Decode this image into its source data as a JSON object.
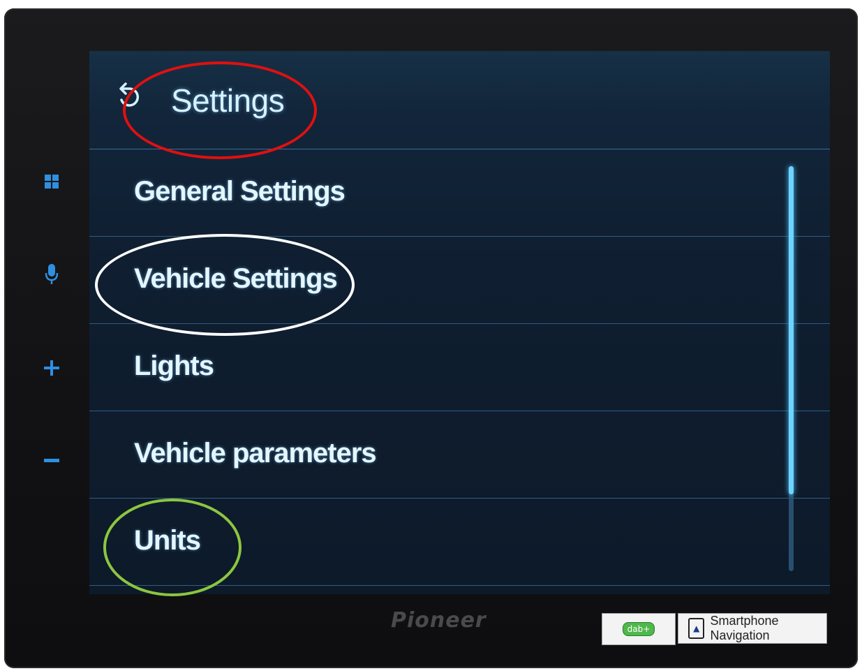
{
  "header": {
    "title": "Settings",
    "back_icon": "back-arrow-icon"
  },
  "side_buttons": [
    {
      "name": "home-grid-icon",
      "glyph": "■"
    },
    {
      "name": "microphone-icon",
      "glyph": "●"
    },
    {
      "name": "volume-up-icon",
      "glyph": "+"
    },
    {
      "name": "volume-down-icon",
      "glyph": "−"
    }
  ],
  "menu": {
    "items": [
      {
        "label": "General Settings"
      },
      {
        "label": "Vehicle Settings"
      },
      {
        "label": "Lights"
      },
      {
        "label": "Vehicle parameters"
      },
      {
        "label": "Units"
      }
    ]
  },
  "scroll": {
    "visible_fraction": 0.81
  },
  "device": {
    "brand": "Pioneer",
    "dab_badge": "dab+",
    "nav_badge": "Smartphone Navigation"
  },
  "annotations": [
    {
      "target": "Settings",
      "color": "#e01010"
    },
    {
      "target": "Vehicle Settings",
      "color": "#ffffff"
    },
    {
      "target": "Units",
      "color": "#8cc63f"
    }
  ]
}
